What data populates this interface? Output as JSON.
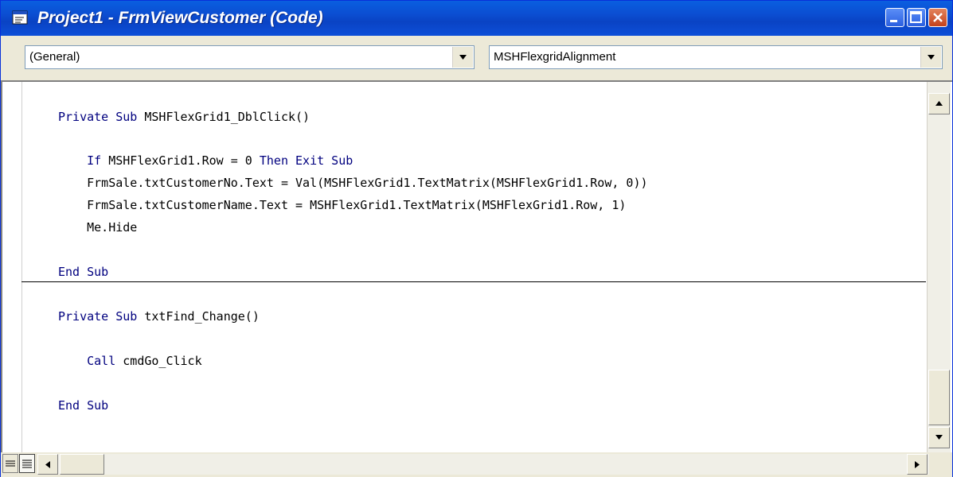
{
  "window": {
    "title": "Project1 - FrmViewCustomer (Code)",
    "title_bar_color": "#0a4fd6"
  },
  "object_combo": {
    "value": "(General)"
  },
  "procedure_combo": {
    "value": "MSHFlexgridAlignment"
  },
  "colors": {
    "keyword": "#00007f",
    "text": "#000000",
    "chrome": "#ece9d8"
  },
  "code": {
    "procedures": [
      {
        "lines": [
          "Private Sub MSHFlexGrid1_DblClick()",
          "",
          "    If MSHFlexGrid1.Row = 0 Then Exit Sub",
          "    FrmSale.txtCustomerNo.Text = Val(MSHFlexGrid1.TextMatrix(MSHFlexGrid1.Row, 0))",
          "    FrmSale.txtCustomerName.Text = MSHFlexGrid1.TextMatrix(MSHFlexGrid1.Row, 1)",
          "    Me.Hide",
          "",
          "End Sub"
        ]
      },
      {
        "lines": [
          "Private Sub txtFind_Change()",
          "",
          "    Call cmdGo_Click",
          "",
          "End Sub"
        ]
      }
    ]
  },
  "icons": {
    "app": "code-window-icon",
    "minimize": "minimize-icon",
    "maximize": "maximize-icon",
    "close": "close-icon",
    "procedure_view": "procedure-view-icon",
    "full_module_view": "full-module-view-icon"
  }
}
